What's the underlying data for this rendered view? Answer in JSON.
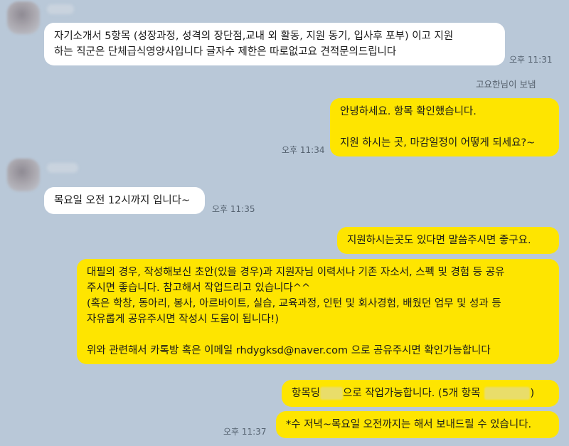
{
  "messages": [
    {
      "text": "자기소개서 5항목 (성장과정, 성격의 장단점,교내 외 활동, 지원 동기, 입사후 포부) 이고 지원\n하는 직군은 단체급식영양사입니다 글자수 제한은 따로없고요 견적문의드립니다",
      "time": "오후 11:31"
    },
    {
      "sender_note": "고요한님이 보냄"
    },
    {
      "text": "안녕하세요. 항목 확인했습니다.\n\n지원 하시는 곳, 마감일정이 어떻게 되세요?~",
      "time": "오후 11:34"
    },
    {
      "text": "목요일 오전 12시까지 입니다~",
      "time": "오후 11:35"
    },
    {
      "text": "지원하시는곳도 있다면 말씀주시면 좋구요."
    },
    {
      "text": "대필의 경우, 작성해보신 초안(있을 경우)과 지원자님 이력서나 기존 자소서, 스펙 및 경험 등 공유\n주시면 좋습니다. 참고해서 작업드리고 있습니다^^\n(혹은 학창, 동아리, 봉사, 아르바이트, 실습, 교육과정, 인턴 및 회사경험, 배웠던 업무 및 성과 등\n자유롭게 공유주시면 작성시 도움이 됩니다!)\n\n위와 관련해서 카톡방 혹은 이메일 rhdygksd@naver.com 으로 공유주시면 확인가능합니다"
    },
    {
      "text_a": "항목딩",
      "text_b": "으로 작업가능합니다. (5개 항목",
      "text_c": ")"
    },
    {
      "text": "*수 저녁~목요일 오전까지는 해서 보내드릴 수 있습니다.",
      "time": "오후 11:37"
    }
  ]
}
